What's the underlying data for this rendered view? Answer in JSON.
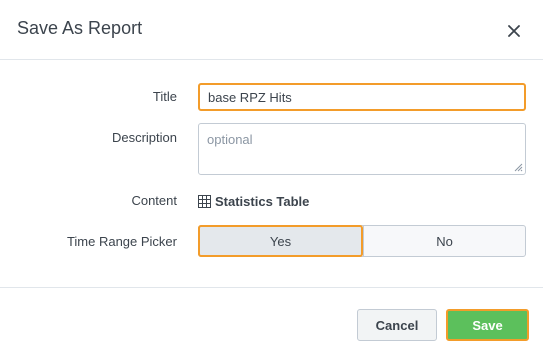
{
  "dialog": {
    "title": "Save As Report",
    "close_icon": "close-icon"
  },
  "form": {
    "title_label": "Title",
    "title_value": "base RPZ Hits",
    "description_label": "Description",
    "description_placeholder": "optional",
    "content_label": "Content",
    "content_icon": "table-icon",
    "content_value": "Statistics Table",
    "time_range_label": "Time Range Picker",
    "time_range_options": [
      "Yes",
      "No"
    ],
    "time_range_selected": "Yes"
  },
  "footer": {
    "cancel_label": "Cancel",
    "save_label": "Save"
  },
  "colors": {
    "focus_outline": "#f39c2a",
    "save_green": "#5cc05c",
    "text": "#3c444d"
  }
}
